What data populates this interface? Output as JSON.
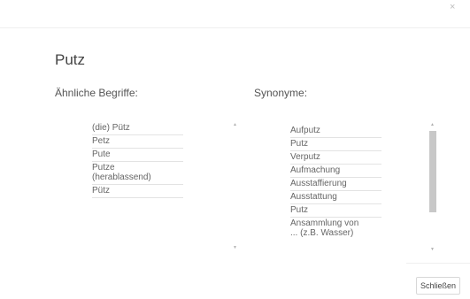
{
  "dialog": {
    "close_glyph": "×",
    "title": "Putz",
    "close_button_label": "Schließen"
  },
  "similar_terms": {
    "heading": "Ähnliche Begriffe:",
    "items": [
      "(die) Pütz",
      "Petz",
      "Pute",
      "Putze\n(herablassend)",
      "Pütz"
    ]
  },
  "synonyms": {
    "heading": "Synonyme:",
    "items": [
      "Aufputz",
      "Putz",
      "Verputz",
      "Aufmachung",
      "Ausstaffierung",
      "Ausstattung",
      "Putz",
      "Ansammlung von\n... (z.B. Wasser)"
    ]
  },
  "icons": {
    "close": "close-icon",
    "scroll_up": "triangle-up-icon",
    "scroll_down": "triangle-down-icon"
  }
}
